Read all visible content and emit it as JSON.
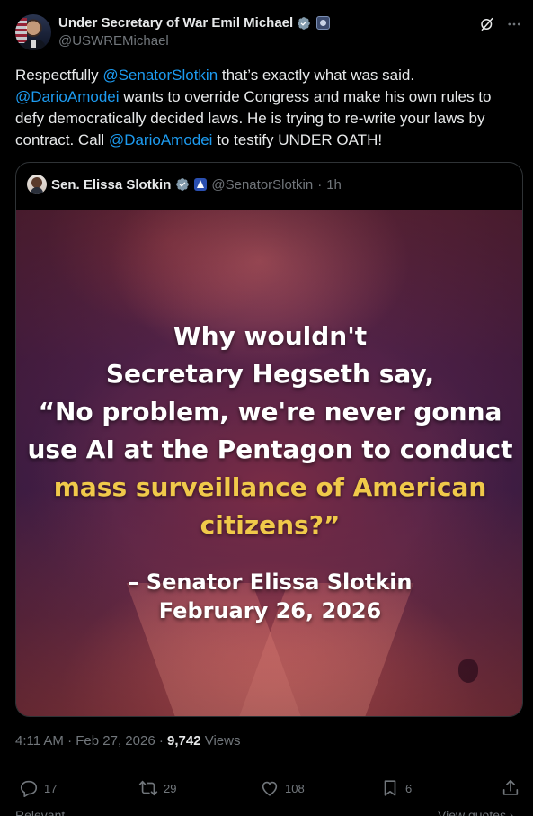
{
  "author": {
    "display_name": "Under Secretary of War Emil Michael",
    "handle": "@USWREMichael"
  },
  "tweet": {
    "segments": [
      {
        "type": "text",
        "text": "Respectfully "
      },
      {
        "type": "mention",
        "text": "@SenatorSlotkin"
      },
      {
        "type": "text",
        "text": " that’s exactly what was said. "
      },
      {
        "type": "mention",
        "text": "@DarioAmodei"
      },
      {
        "type": "text",
        "text": " wants to override Congress and make his own rules to defy democratically decided laws.  He is trying to re-write your laws by contract. Call "
      },
      {
        "type": "mention",
        "text": "@DarioAmodei"
      },
      {
        "type": "text",
        "text": " to testify UNDER OATH!"
      }
    ]
  },
  "quoted": {
    "display_name": "Sen. Elissa Slotkin",
    "handle": "@SenatorSlotkin",
    "separator": "·",
    "time": "1h",
    "image_text": {
      "line1": "Why wouldn't",
      "line2": "Secretary Hegseth say,",
      "line3": "“No problem, we're never gonna",
      "line4": "use AI at the Pentagon to conduct",
      "line5": "mass surveillance of American",
      "line6": "citizens?”",
      "attribution": "– Senator Elissa Slotkin",
      "date": "February 26, 2026"
    }
  },
  "meta": {
    "time": "4:11 AM",
    "sep1": " · ",
    "date": "Feb 27, 2026",
    "sep2": " · ",
    "views_count": "9,742",
    "views_label": " Views"
  },
  "actions": {
    "replies": "17",
    "reposts": "29",
    "likes": "108",
    "bookmarks": "6"
  },
  "bottom": {
    "left": "Relevant",
    "right": "View quotes ›"
  },
  "colors": {
    "background": "#000000",
    "text": "#e7e9ea",
    "muted": "#71767b",
    "link": "#1d9bf0",
    "verified": "#829aab",
    "highlight": "#f0c94a",
    "border": "#2f3336"
  },
  "icons": [
    "verified-badge-icon",
    "affiliation-icon",
    "grok-icon",
    "more-icon",
    "reply-icon",
    "repost-icon",
    "like-icon",
    "bookmark-icon",
    "share-icon"
  ]
}
